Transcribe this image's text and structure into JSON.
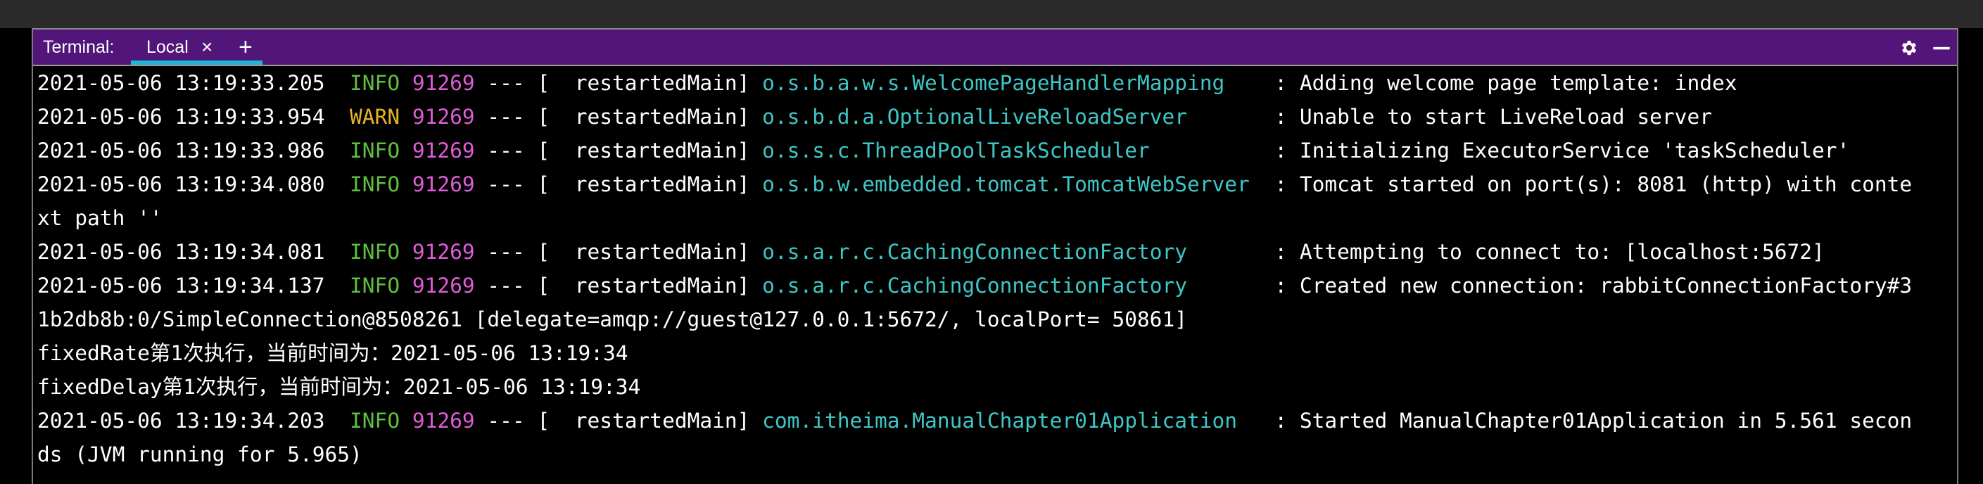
{
  "header": {
    "label": "Terminal:",
    "tab": {
      "label": "Local",
      "close_glyph": "×"
    },
    "add_glyph": "+",
    "icons": [
      "gear-icon",
      "minimize-icon"
    ]
  },
  "colors": {
    "header_bg": "#52167a",
    "tab_underline": "#1fb5d8",
    "info": "#5fbf3f",
    "warn": "#e6b422",
    "pid": "#e05bd6",
    "logger": "#3fc6c6"
  },
  "log_lines": [
    {
      "type": "log",
      "ts": "2021-05-06 13:19:33.205",
      "gap": "  ",
      "level": "INFO",
      "pid": "91269",
      "mid": " --- [  restartedMain] ",
      "logger": "o.s.b.a.w.s.WelcomePageHandlerMapping",
      "pad": "    ",
      "message": ": Adding welcome page template: index"
    },
    {
      "type": "log",
      "ts": "2021-05-06 13:19:33.954",
      "gap": "  ",
      "level": "WARN",
      "pid": "91269",
      "mid": " --- [  restartedMain] ",
      "logger": "o.s.b.d.a.OptionalLiveReloadServer",
      "pad": "       ",
      "message": ": Unable to start LiveReload server"
    },
    {
      "type": "log",
      "ts": "2021-05-06 13:19:33.986",
      "gap": "  ",
      "level": "INFO",
      "pid": "91269",
      "mid": " --- [  restartedMain] ",
      "logger": "o.s.s.c.ThreadPoolTaskScheduler",
      "pad": "          ",
      "message": ": Initializing ExecutorService 'taskScheduler'"
    },
    {
      "type": "log",
      "ts": "2021-05-06 13:19:34.080",
      "gap": "  ",
      "level": "INFO",
      "pid": "91269",
      "mid": " --- [  restartedMain] ",
      "logger": "o.s.b.w.embedded.tomcat.TomcatWebServer",
      "pad": "  ",
      "message": ": Tomcat started on port(s): 8081 (http) with conte"
    },
    {
      "type": "plain",
      "text": "xt path ''"
    },
    {
      "type": "log",
      "ts": "2021-05-06 13:19:34.081",
      "gap": "  ",
      "level": "INFO",
      "pid": "91269",
      "mid": " --- [  restartedMain] ",
      "logger": "o.s.a.r.c.CachingConnectionFactory",
      "pad": "       ",
      "message": ": Attempting to connect to: [localhost:5672]"
    },
    {
      "type": "log",
      "ts": "2021-05-06 13:19:34.137",
      "gap": "  ",
      "level": "INFO",
      "pid": "91269",
      "mid": " --- [  restartedMain] ",
      "logger": "o.s.a.r.c.CachingConnectionFactory",
      "pad": "       ",
      "message": ": Created new connection: rabbitConnectionFactory#3"
    },
    {
      "type": "plain",
      "text": "1b2db8b:0/SimpleConnection@8508261 [delegate=amqp://guest@127.0.0.1:5672/, localPort= 50861]"
    },
    {
      "type": "plain",
      "text": "fixedRate第1次执行，当前时间为：2021-05-06 13:19:34"
    },
    {
      "type": "plain",
      "text": "fixedDelay第1次执行，当前时间为：2021-05-06 13:19:34"
    },
    {
      "type": "log",
      "ts": "2021-05-06 13:19:34.203",
      "gap": "  ",
      "level": "INFO",
      "pid": "91269",
      "mid": " --- [  restartedMain] ",
      "logger": "com.itheima.ManualChapter01Application",
      "pad": "   ",
      "message": ": Started ManualChapter01Application in 5.561 secon"
    },
    {
      "type": "plain",
      "text": "ds (JVM running for 5.965)"
    }
  ]
}
